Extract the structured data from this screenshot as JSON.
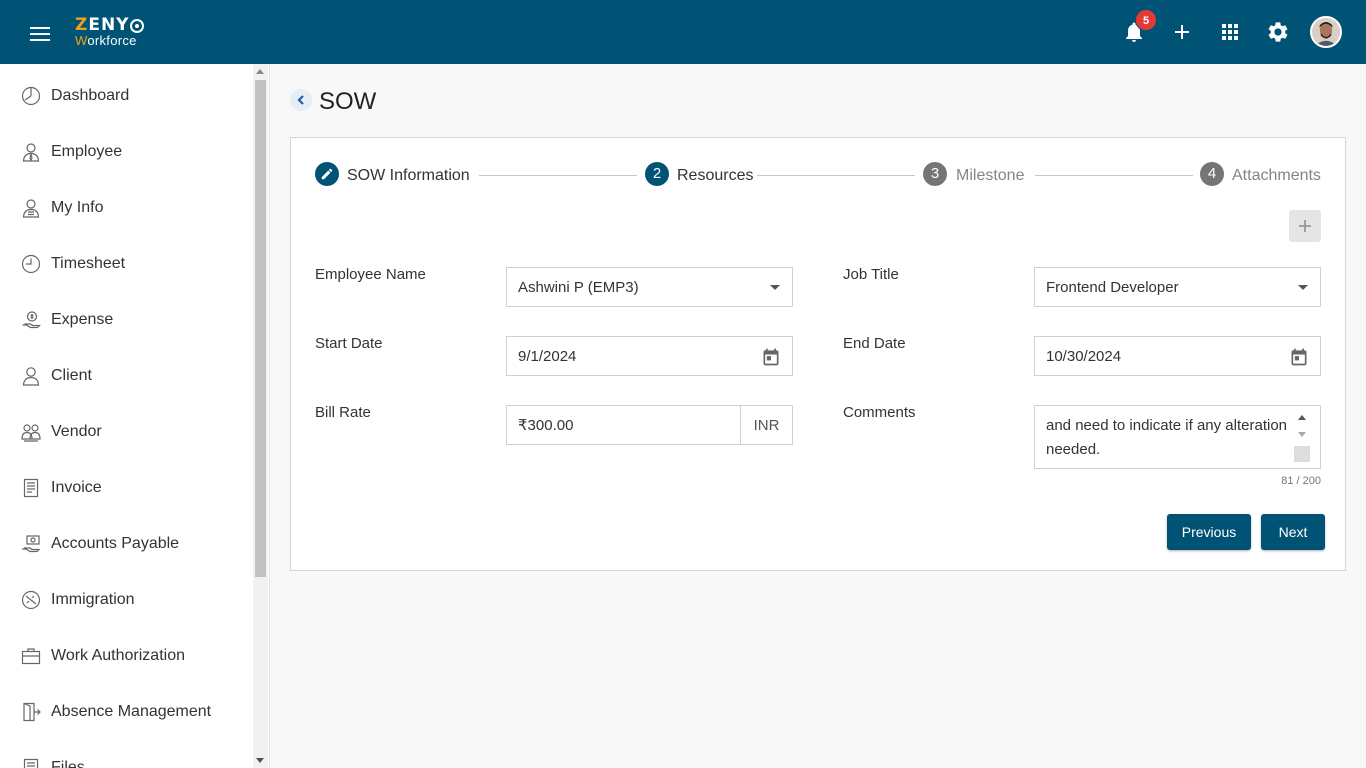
{
  "header": {
    "logo_top_first": "Z",
    "logo_top_rest": "ENY",
    "logo_bottom_first": "W",
    "logo_bottom_rest": "orkforce",
    "notification_count": "5",
    "colors": {
      "brand": "#015375",
      "accent": "#f0a020",
      "badge": "#e53935"
    },
    "icons": [
      "menu-icon",
      "bell-icon",
      "plus-icon",
      "apps-grid-icon",
      "gear-icon",
      "user-avatar"
    ]
  },
  "sidebar": {
    "items": [
      {
        "label": "Dashboard",
        "icon": "clock-pie-icon"
      },
      {
        "label": "Employee",
        "icon": "person-tie-icon"
      },
      {
        "label": "My Info",
        "icon": "person-info-icon"
      },
      {
        "label": "Timesheet",
        "icon": "clock-icon"
      },
      {
        "label": "Expense",
        "icon": "money-hand-icon"
      },
      {
        "label": "Client",
        "icon": "person-icon"
      },
      {
        "label": "Vendor",
        "icon": "people-group-icon"
      },
      {
        "label": "Invoice",
        "icon": "invoice-icon"
      },
      {
        "label": "Accounts Payable",
        "icon": "payment-hand-icon"
      },
      {
        "label": "Immigration",
        "icon": "globe-plane-icon"
      },
      {
        "label": "Work Authorization",
        "icon": "briefcase-icon"
      },
      {
        "label": "Absence Management",
        "icon": "door-exit-icon"
      },
      {
        "label": "Files",
        "icon": "file-icon"
      }
    ]
  },
  "page": {
    "title": "SOW",
    "steps": [
      {
        "number": "",
        "label": "SOW Information",
        "state": "active"
      },
      {
        "number": "2",
        "label": "Resources",
        "state": "active"
      },
      {
        "number": "3",
        "label": "Milestone",
        "state": "inactive"
      },
      {
        "number": "4",
        "label": "Attachments",
        "state": "inactive"
      }
    ],
    "form": {
      "employee_name_label": "Employee Name",
      "employee_name_value": "Ashwini P (EMP3)",
      "job_title_label": "Job Title",
      "job_title_value": "Frontend Developer",
      "start_date_label": "Start Date",
      "start_date_value": "9/1/2024",
      "end_date_label": "End Date",
      "end_date_value": "10/30/2024",
      "bill_rate_label": "Bill Rate",
      "bill_rate_value": "₹300.00",
      "bill_rate_currency": "INR",
      "comments_label": "Comments",
      "comments_value": "and need to indicate if any alteration needed.",
      "comments_counter": "81 / 200"
    },
    "buttons": {
      "previous": "Previous",
      "next": "Next"
    }
  }
}
